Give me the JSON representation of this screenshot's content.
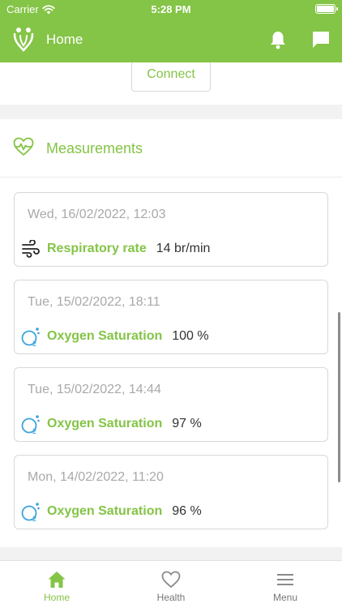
{
  "status_bar": {
    "carrier": "Carrier",
    "time": "5:28 PM"
  },
  "header": {
    "title": "Home"
  },
  "device": {
    "connect_label": "Connect"
  },
  "measurements": {
    "title": "Measurements",
    "items": [
      {
        "date": "Wed, 16/02/2022, 12:03",
        "name": "Respiratory rate",
        "value": "14 br/min",
        "icon": "respiratory-icon"
      },
      {
        "date": "Tue, 15/02/2022, 18:11",
        "name": "Oxygen Saturation",
        "value": "100 %",
        "icon": "oxygen-icon"
      },
      {
        "date": "Tue, 15/02/2022, 14:44",
        "name": "Oxygen Saturation",
        "value": "97 %",
        "icon": "oxygen-icon"
      },
      {
        "date": "Mon, 14/02/2022, 11:20",
        "name": "Oxygen Saturation",
        "value": "96 %",
        "icon": "oxygen-icon"
      }
    ]
  },
  "tabs": [
    {
      "label": "Home",
      "icon": "home-icon",
      "active": true
    },
    {
      "label": "Health",
      "icon": "heart-outline-icon",
      "active": false
    },
    {
      "label": "Menu",
      "icon": "hamburger-menu-icon",
      "active": false
    }
  ],
  "colors": {
    "brand": "#84c446",
    "oxygen_icon": "#3aa3dc",
    "text_muted": "#a9a9a9"
  }
}
